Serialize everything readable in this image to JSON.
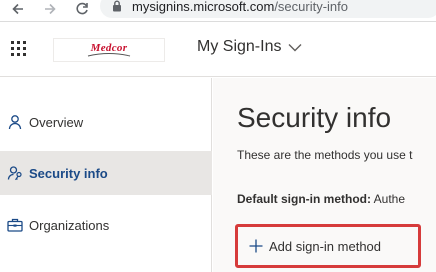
{
  "browser": {
    "url_host": "mysignins.microsoft.com",
    "url_path": "/security-info"
  },
  "header": {
    "logo_text": "Medcor",
    "app_title": "My Sign-Ins"
  },
  "sidebar": {
    "items": [
      {
        "label": "Overview",
        "icon": "person-icon",
        "active": false
      },
      {
        "label": "Security info",
        "icon": "person-key-icon",
        "active": true
      },
      {
        "label": "Organizations",
        "icon": "briefcase-icon",
        "active": false
      }
    ]
  },
  "main": {
    "title": "Security info",
    "subtitle": "These are the methods you use t",
    "default_method_label": "Default sign-in method:",
    "default_method_value": " Authe",
    "add_method_label": "Add sign-in method"
  },
  "colors": {
    "accent": "#1b4a87",
    "highlight_border": "#d63b3b",
    "logo_red": "#c8102e"
  }
}
